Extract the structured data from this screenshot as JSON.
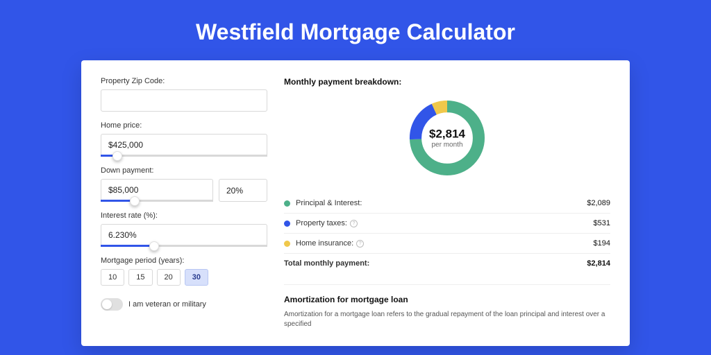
{
  "title": "Westfield Mortgage Calculator",
  "form": {
    "zip_label": "Property Zip Code:",
    "zip_value": "",
    "home_price_label": "Home price:",
    "home_price_value": "$425,000",
    "down_payment_label": "Down payment:",
    "down_payment_value": "$85,000",
    "down_payment_pct": "20%",
    "interest_label": "Interest rate (%):",
    "interest_value": "6.230%",
    "period_label": "Mortgage period (years):",
    "period_options": [
      "10",
      "15",
      "20",
      "30"
    ],
    "period_selected": "30",
    "veteran_label": "I am veteran or military"
  },
  "breakdown": {
    "title": "Monthly payment breakdown:",
    "center_value": "$2,814",
    "center_sub": "per month",
    "items": [
      {
        "label": "Principal & Interest:",
        "amount": "$2,089",
        "color": "#4db089",
        "info": false,
        "value": 2089
      },
      {
        "label": "Property taxes:",
        "amount": "$531",
        "color": "#3155e8",
        "info": true,
        "value": 531
      },
      {
        "label": "Home insurance:",
        "amount": "$194",
        "color": "#f0c84b",
        "info": true,
        "value": 194
      }
    ],
    "total_label": "Total monthly payment:",
    "total_amount": "$2,814"
  },
  "amort": {
    "title": "Amortization for mortgage loan",
    "text": "Amortization for a mortgage loan refers to the gradual repayment of the loan principal and interest over a specified"
  },
  "chart_data": {
    "type": "pie",
    "title": "Monthly payment breakdown",
    "categories": [
      "Principal & Interest",
      "Property taxes",
      "Home insurance"
    ],
    "values": [
      2089,
      531,
      194
    ],
    "colors": [
      "#4db089",
      "#3155e8",
      "#f0c84b"
    ],
    "center_label": "$2,814 per month"
  }
}
